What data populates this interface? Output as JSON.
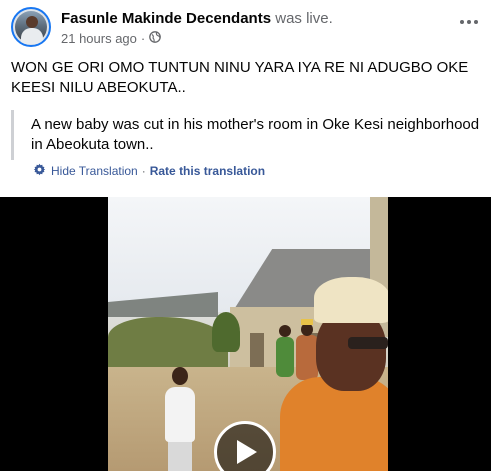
{
  "post": {
    "author": "Fasunle Makinde Decendants",
    "status_suffix": "was live.",
    "timestamp": "21 hours ago",
    "separator": "·",
    "privacy_icon": "globe-icon",
    "more_icon": "more-options-icon",
    "text": "WON GE ORI OMO TUNTUN NINU YARA IYA RE NI ADUGBO OKE KEESI NILU ABEOKUTA.."
  },
  "translation": {
    "text": "A new baby was cut in his mother's room in Oke Kesi neighborhood in Abeokuta town..",
    "icon": "gear-icon",
    "hide_label": "Hide Translation",
    "separator": "·",
    "rate_label": "Rate this translation"
  },
  "video": {
    "play_icon": "play-icon"
  },
  "colors": {
    "link": "#385898",
    "meta": "#65676b",
    "live_ring": "#1877f2"
  }
}
